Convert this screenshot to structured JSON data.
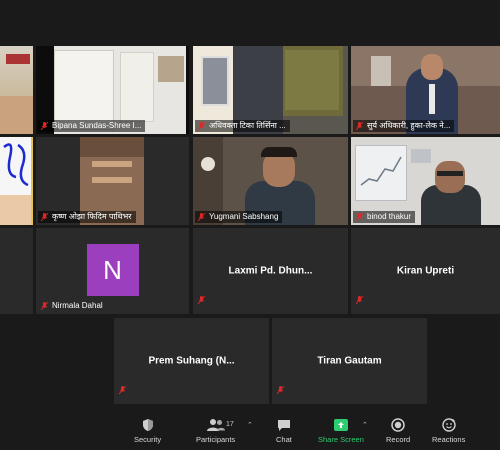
{
  "participants": {
    "row1": [
      {
        "name": ""
      },
      {
        "name": "Bipana Sundas-Shree I..."
      },
      {
        "name": "अधिवक्ता टिका तिर्सिना ..."
      },
      {
        "name": "सुर्य अधिकारी, हुका-लेक ने..."
      }
    ],
    "row2": [
      {
        "name": ""
      },
      {
        "name": "कृष्ण ओझा फिदिम पाथिभर"
      },
      {
        "name": "Yugmani Sabshang"
      },
      {
        "name": "binod thakur"
      }
    ],
    "row3": [
      {
        "name": "Nirmala Dahal",
        "avatar_letter": "N",
        "avatar_color": "#9b3fbf"
      },
      {
        "name": "Laxmi Pd. Dhun..."
      },
      {
        "name": "Kiran Upreti"
      }
    ],
    "row4": [
      {
        "name": "Prem Suhang (N..."
      },
      {
        "name": "Tiran Gautam"
      }
    ]
  },
  "toolbar": {
    "security": "Security",
    "participants": "Participants",
    "participant_count": "17",
    "chat": "Chat",
    "share_screen": "Share Screen",
    "record": "Record",
    "reactions": "Reactions"
  },
  "colors": {
    "background": "#1a1a1a",
    "tile": "#2a2a2a",
    "share_green": "#2ecc71",
    "mic_red": "#e02828"
  }
}
